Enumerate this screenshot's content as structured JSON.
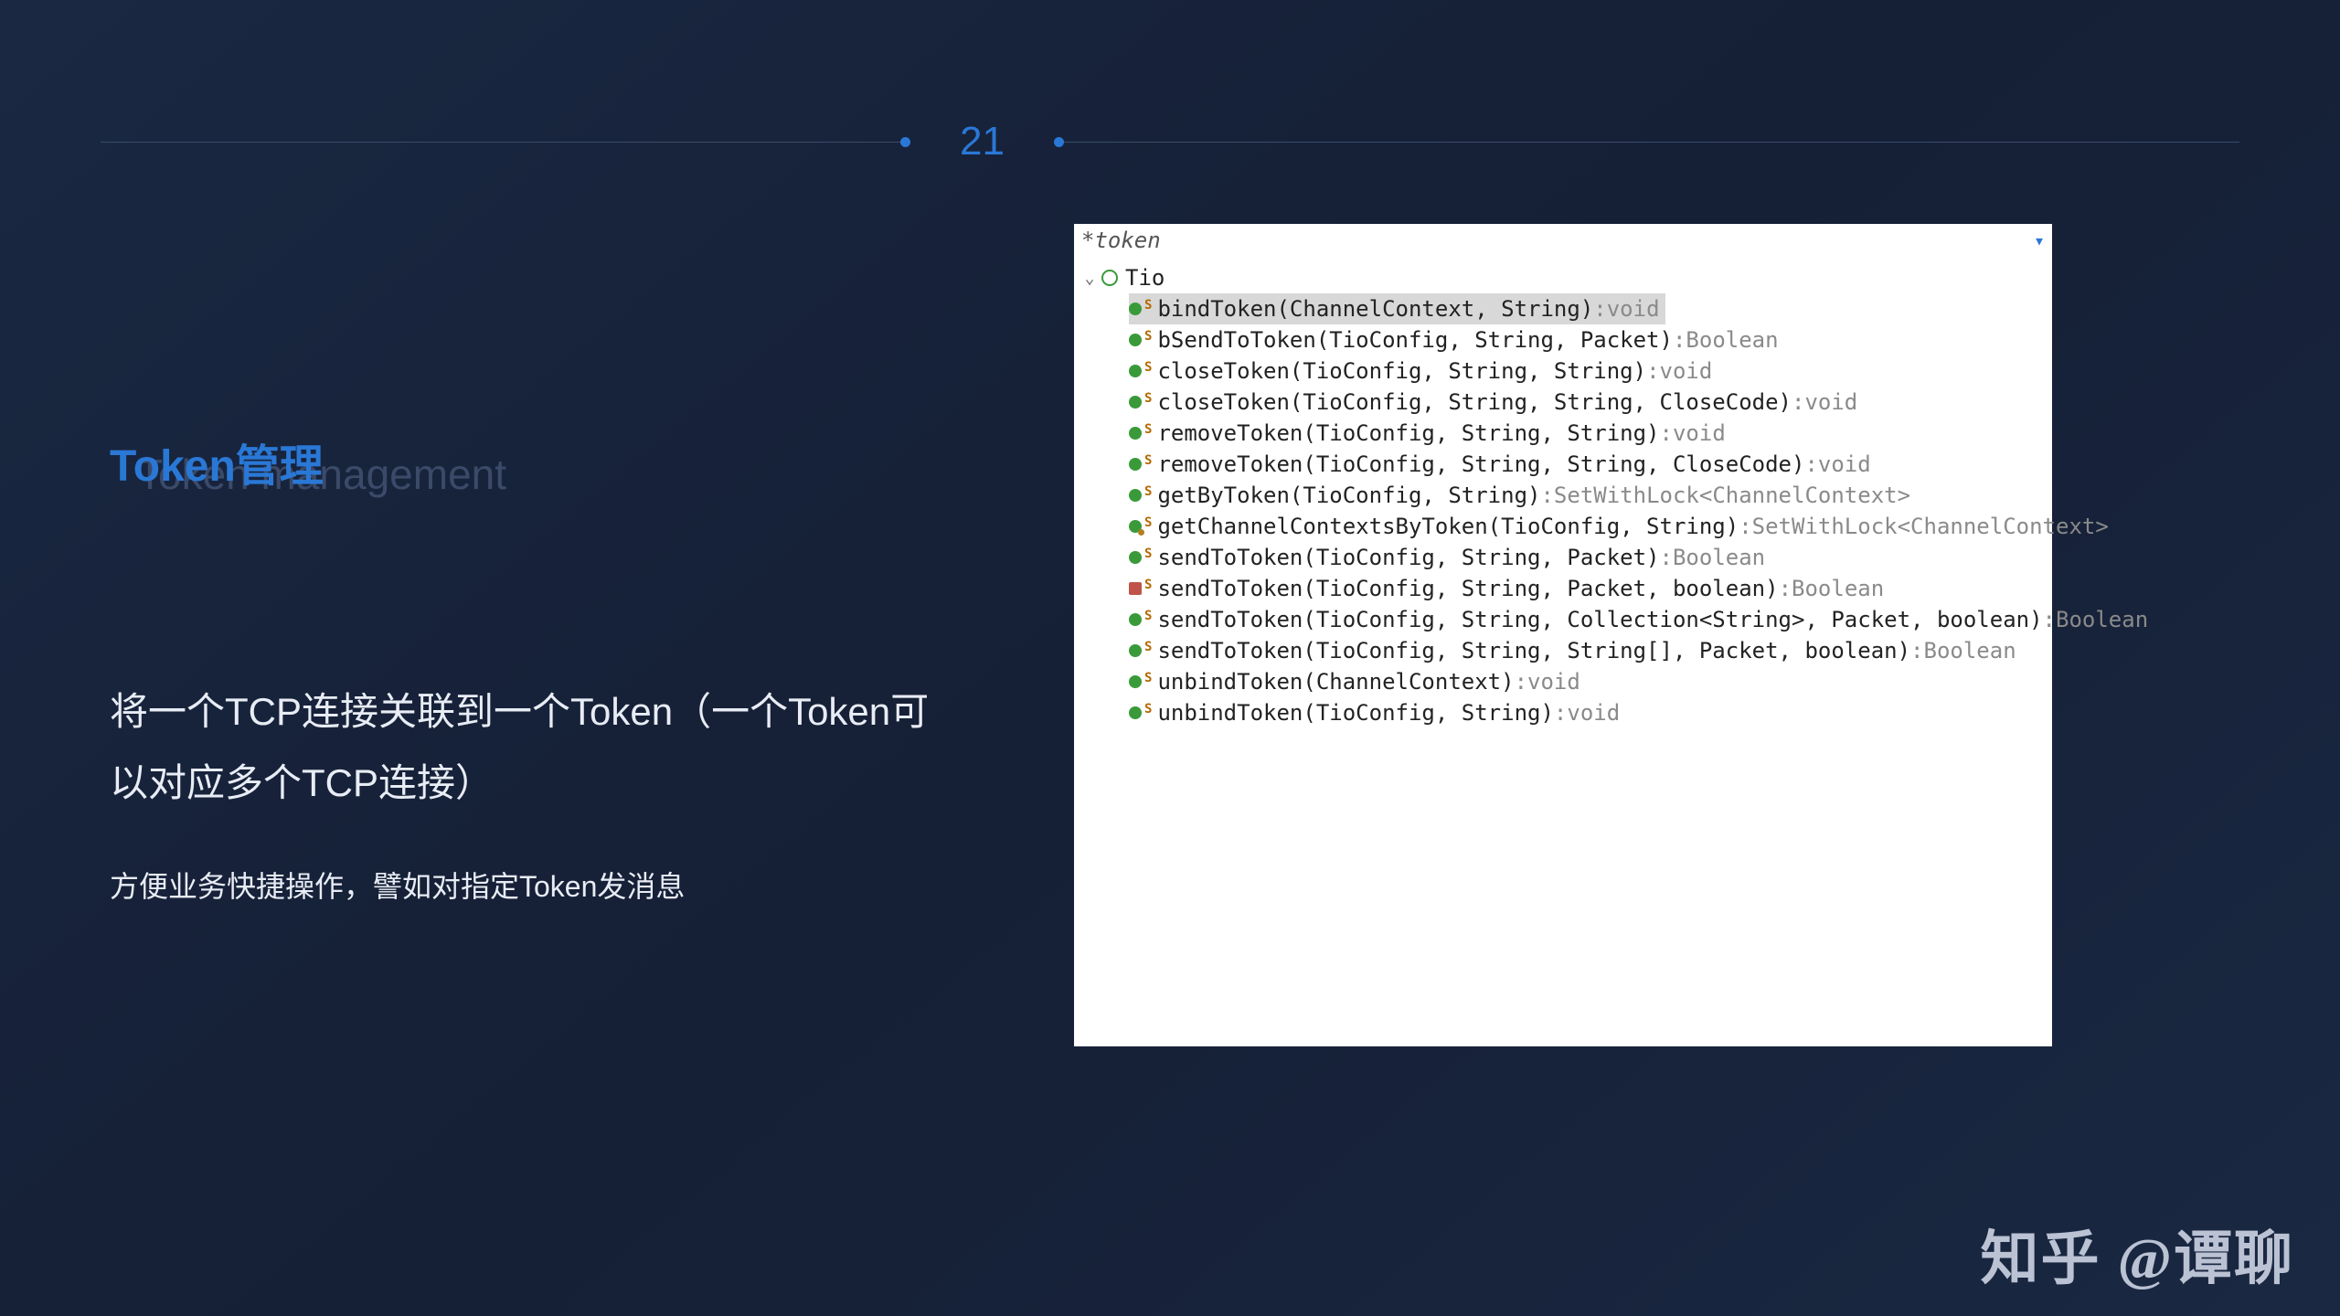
{
  "slide_number": "21",
  "title_cn": "Token管理",
  "title_en": "Token management",
  "desc_main": "将一个TCP连接关联到一个Token（一个Token可以对应多个TCP连接）",
  "desc_sub": "方便业务快捷操作，譬如对指定Token发消息",
  "watermark": "知乎 @谭聊",
  "ide": {
    "filter": "*token",
    "class_name": "Tio",
    "methods": [
      {
        "sig": "bindToken(ChannelContext, String)",
        "ret": "void",
        "sel": true,
        "dep": false,
        "pkg": false
      },
      {
        "sig": "bSendToToken(TioConfig, String, Packet)",
        "ret": "Boolean",
        "sel": false,
        "dep": false,
        "pkg": false
      },
      {
        "sig": "closeToken(TioConfig, String, String)",
        "ret": "void",
        "sel": false,
        "dep": false,
        "pkg": false
      },
      {
        "sig": "closeToken(TioConfig, String, String, CloseCode)",
        "ret": "void",
        "sel": false,
        "dep": false,
        "pkg": false
      },
      {
        "sig": "removeToken(TioConfig, String, String)",
        "ret": "void",
        "sel": false,
        "dep": false,
        "pkg": false
      },
      {
        "sig": "removeToken(TioConfig, String, String, CloseCode)",
        "ret": "void",
        "sel": false,
        "dep": false,
        "pkg": false
      },
      {
        "sig": "getByToken(TioConfig, String)",
        "ret": "SetWithLock<ChannelContext>",
        "sel": false,
        "dep": false,
        "pkg": false
      },
      {
        "sig": "getChannelContextsByToken(TioConfig, String)",
        "ret": "SetWithLock<ChannelContext>",
        "sel": false,
        "dep": false,
        "pkg": true
      },
      {
        "sig": "sendToToken(TioConfig, String, Packet)",
        "ret": "Boolean",
        "sel": false,
        "dep": false,
        "pkg": false
      },
      {
        "sig": "sendToToken(TioConfig, String, Packet, boolean)",
        "ret": "Boolean",
        "sel": false,
        "dep": true,
        "pkg": false
      },
      {
        "sig": "sendToToken(TioConfig, String, Collection<String>, Packet, boolean)",
        "ret": "Boolean",
        "sel": false,
        "dep": false,
        "pkg": false
      },
      {
        "sig": "sendToToken(TioConfig, String, String[], Packet, boolean)",
        "ret": "Boolean",
        "sel": false,
        "dep": false,
        "pkg": false
      },
      {
        "sig": "unbindToken(ChannelContext)",
        "ret": "void",
        "sel": false,
        "dep": false,
        "pkg": false
      },
      {
        "sig": "unbindToken(TioConfig, String)",
        "ret": "void",
        "sel": false,
        "dep": false,
        "pkg": false
      }
    ]
  }
}
